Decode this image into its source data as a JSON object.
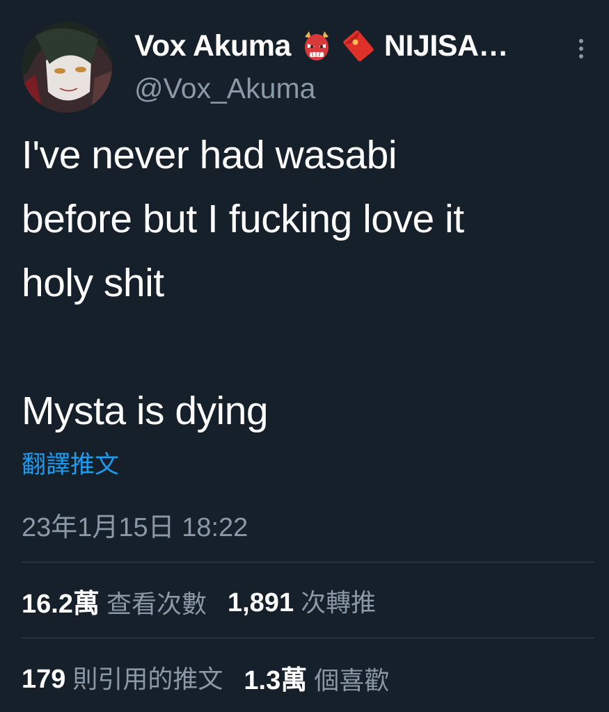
{
  "author": {
    "display_name": "Vox Akuma",
    "name_suffix": "NIJISA…",
    "emoji": [
      "oni-mask-icon",
      "red-envelope-icon"
    ],
    "handle": "@Vox_Akuma"
  },
  "tweet": {
    "lines": [
      "I've never had wasabi",
      "before but I fucking love it",
      "holy shit",
      "Mysta is dying"
    ],
    "translate_label": "翻譯推文",
    "timestamp": "23年1月15日 18:22"
  },
  "stats": {
    "views_value": "16.2萬",
    "views_label": "查看次數",
    "retweets_value": "1,891",
    "retweets_label": "次轉推",
    "quotes_value": "179",
    "quotes_label": "則引用的推文",
    "likes_value": "1.3萬",
    "likes_label": "個喜歡"
  },
  "colors": {
    "background": "#16202b",
    "text": "#ffffff",
    "secondary": "#8b98a5",
    "link": "#1d9bf0",
    "divider": "#38444d"
  }
}
